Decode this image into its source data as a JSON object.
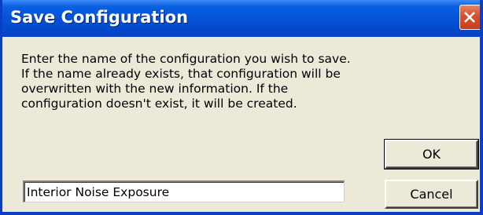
{
  "window": {
    "title": "Save Configuration"
  },
  "message": {
    "lines": [
      "Enter the name of the configuration you wish to save.",
      "If the name already exists, that configuration will be",
      "overwritten with the new information.  If the",
      "configuration doesn't exist, it will be created."
    ]
  },
  "buttons": {
    "ok_label": "OK",
    "cancel_label": "Cancel"
  },
  "name_field": {
    "value": "Interior Noise Exposure"
  },
  "colors": {
    "titlebar": "#0552d8",
    "dialog_background": "#ece9d8",
    "close_button": "#d8532f"
  },
  "icons": {
    "close": "close-icon"
  }
}
